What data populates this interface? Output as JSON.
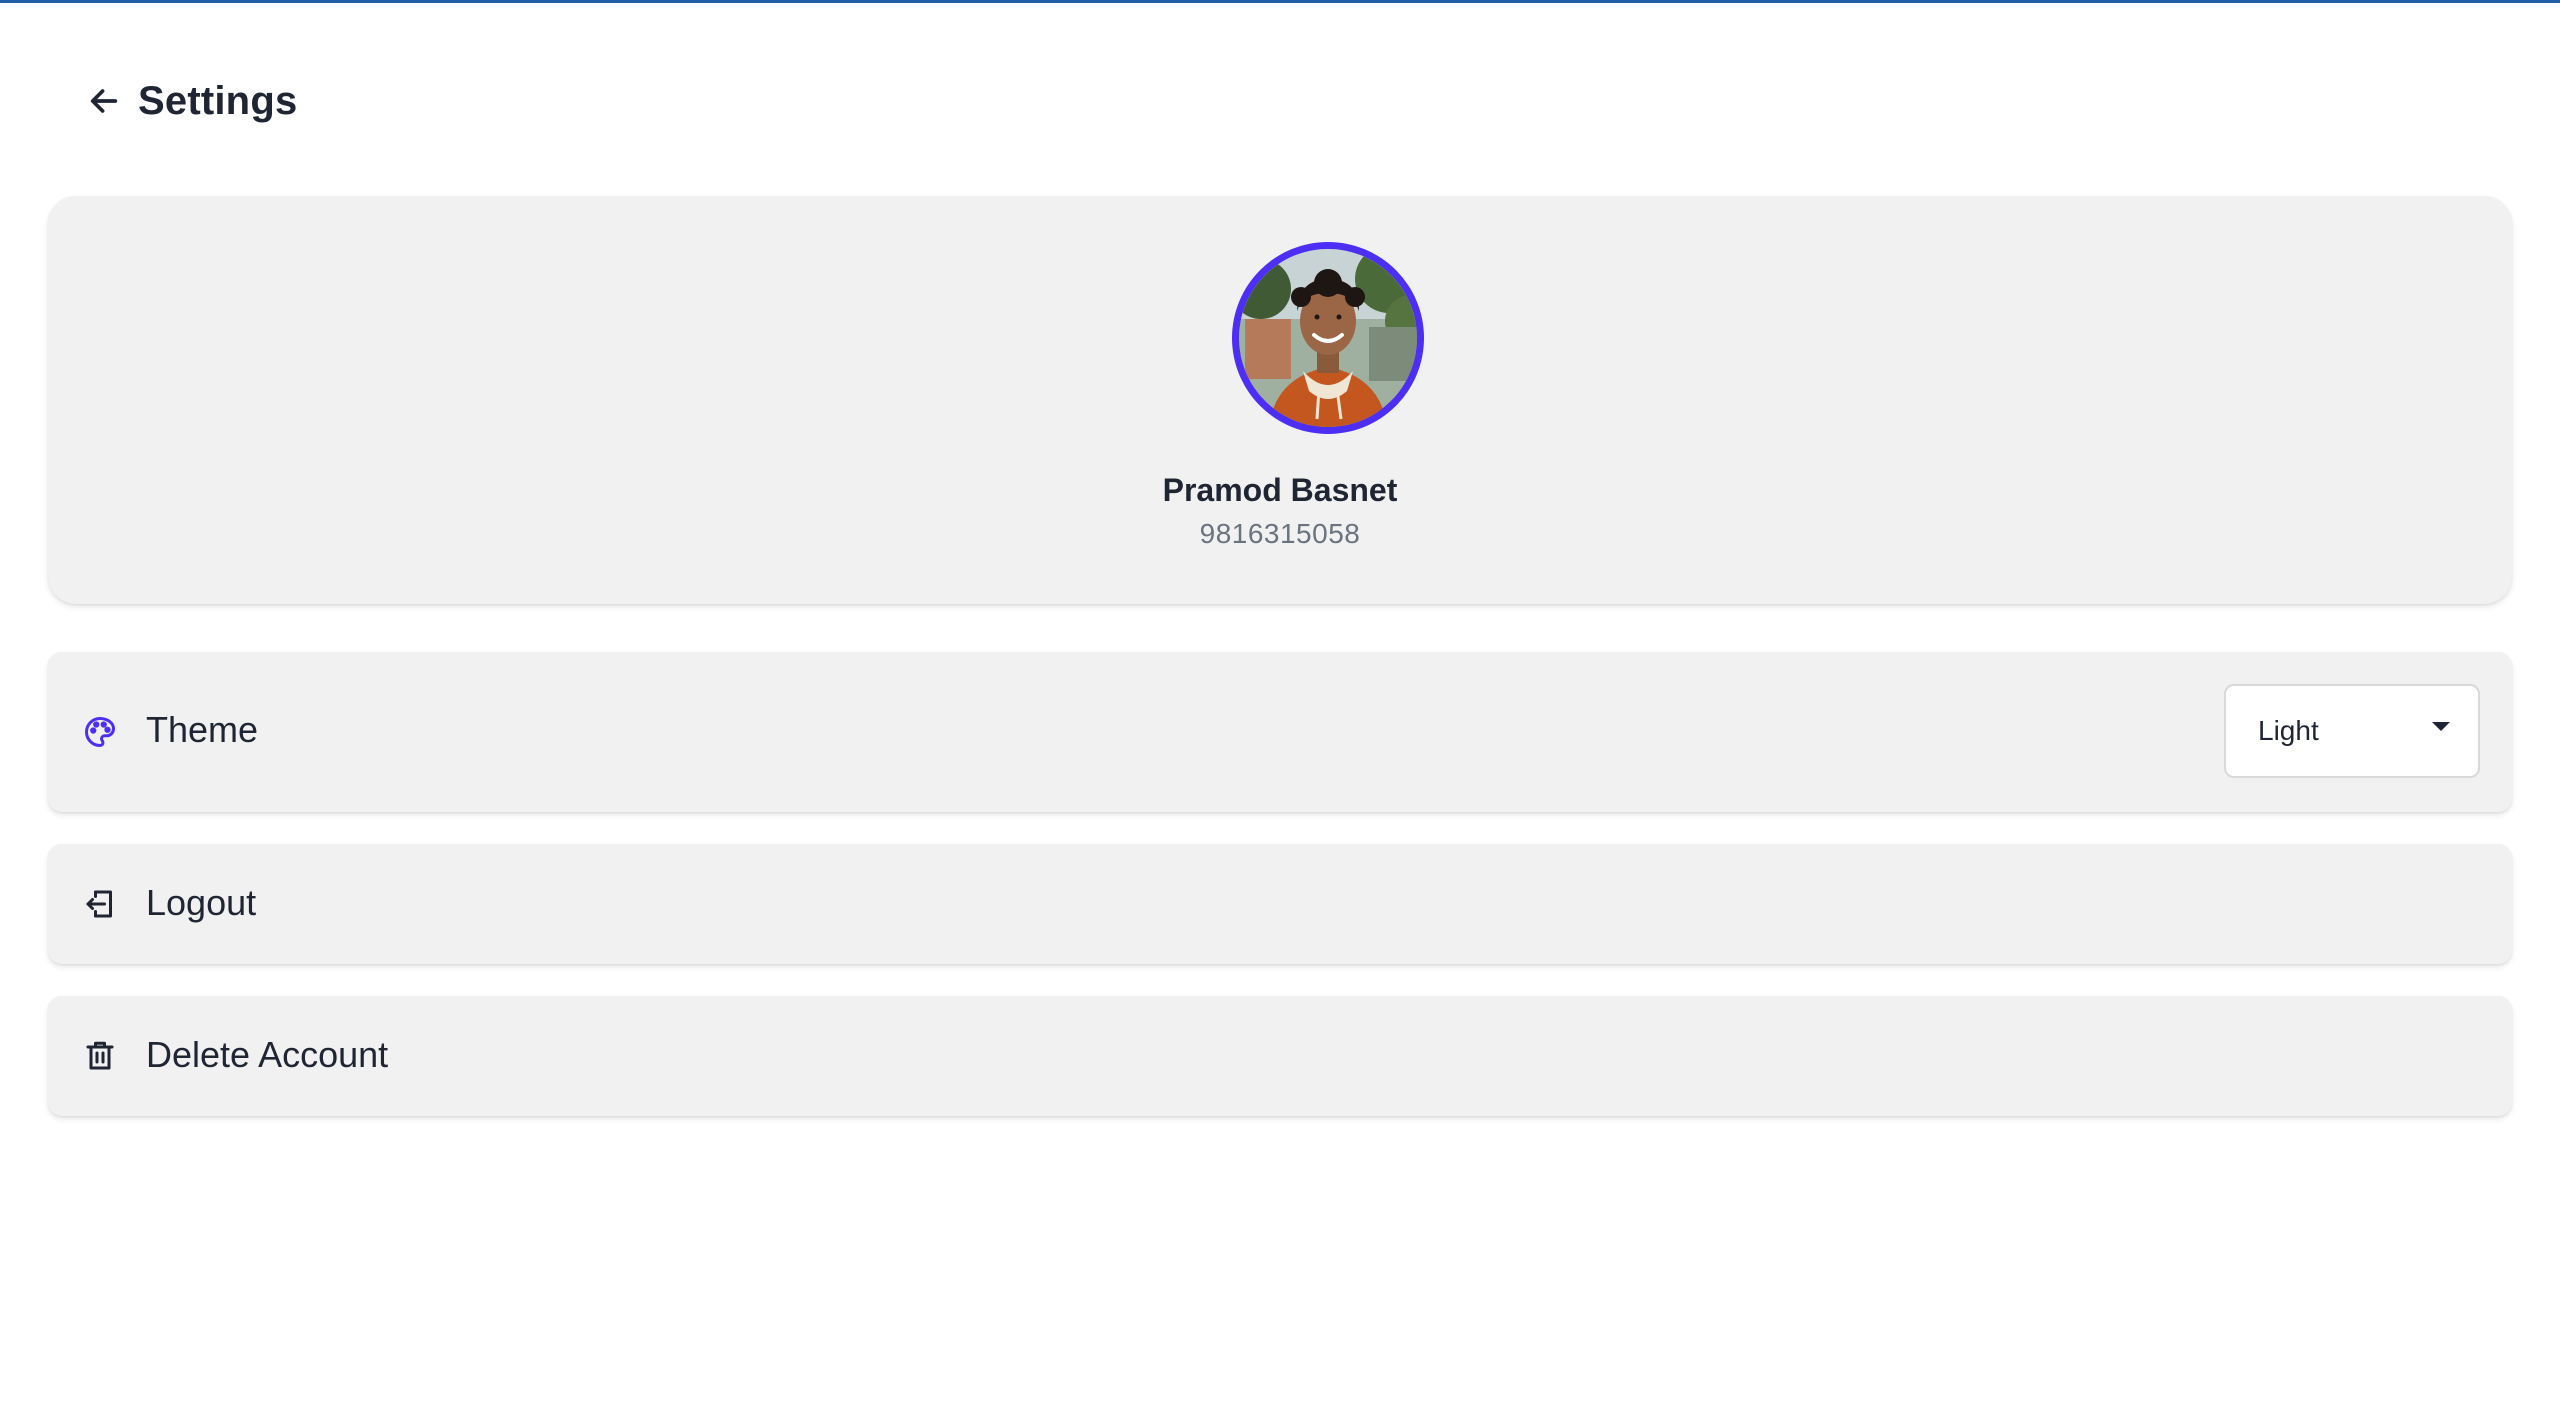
{
  "header": {
    "title": "Settings",
    "back_icon": "arrow-left-icon"
  },
  "profile": {
    "name": "Pramod Basnet",
    "phone": "9816315058",
    "avatar_ring_color": "#4d2ef5"
  },
  "settings": {
    "theme": {
      "label": "Theme",
      "icon": "palette-icon",
      "icon_color": "#4d2ef5",
      "selected": "Light"
    },
    "logout": {
      "label": "Logout",
      "icon": "logout-icon"
    },
    "delete_account": {
      "label": "Delete Account",
      "icon": "trash-icon"
    }
  },
  "colors": {
    "accent": "#4d2ef5",
    "top_line": "#1f5fa8",
    "card_bg": "#f1f1f1",
    "text": "#1f2533",
    "muted_text": "#6b7280"
  }
}
